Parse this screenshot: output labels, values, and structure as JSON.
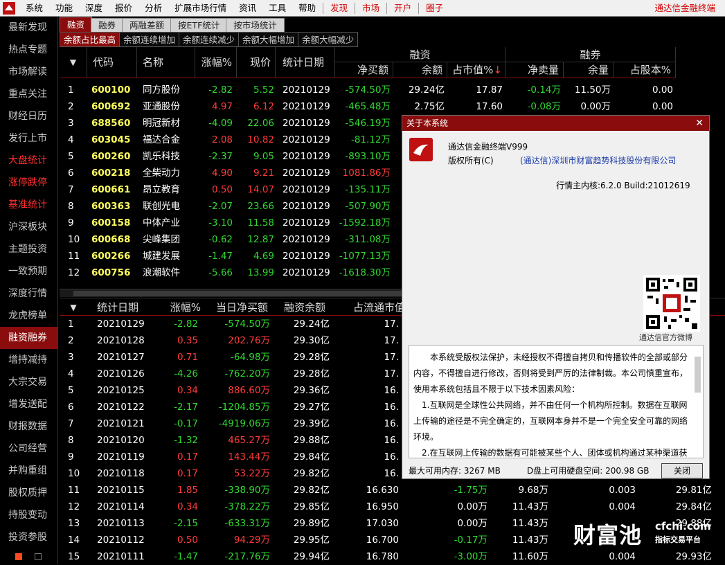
{
  "menubar": {
    "items": [
      "系统",
      "功能",
      "深度",
      "报价",
      "分析",
      "扩展市场行情",
      "资讯",
      "工具",
      "帮助"
    ],
    "red_items": [
      "发现",
      "市场",
      "开户",
      "圈子"
    ],
    "app_title": "通达信金融终端"
  },
  "sidebar": {
    "items": [
      {
        "label": "最新发现",
        "style": "normal"
      },
      {
        "label": "热点专题",
        "style": "normal"
      },
      {
        "label": "市场解读",
        "style": "normal"
      },
      {
        "label": "重点关注",
        "style": "normal"
      },
      {
        "label": "财经日历",
        "style": "normal"
      },
      {
        "label": "发行上市",
        "style": "normal"
      },
      {
        "label": "大盘统计",
        "style": "red"
      },
      {
        "label": "涨停跌停",
        "style": "red"
      },
      {
        "label": "基准统计",
        "style": "red"
      },
      {
        "label": "沪深板块",
        "style": "normal"
      },
      {
        "label": "主题投资",
        "style": "normal"
      },
      {
        "label": "一致预期",
        "style": "normal"
      },
      {
        "label": "深度行情",
        "style": "normal"
      },
      {
        "label": "龙虎榜单",
        "style": "normal"
      },
      {
        "label": "融资融券",
        "style": "active"
      },
      {
        "label": "增持减持",
        "style": "normal"
      },
      {
        "label": "大宗交易",
        "style": "normal"
      },
      {
        "label": "增发送配",
        "style": "normal"
      },
      {
        "label": "财报数据",
        "style": "normal"
      },
      {
        "label": "公司经营",
        "style": "normal"
      },
      {
        "label": "并购重组",
        "style": "normal"
      },
      {
        "label": "股权质押",
        "style": "normal"
      },
      {
        "label": "持股变动",
        "style": "normal"
      },
      {
        "label": "投资参股",
        "style": "normal"
      }
    ]
  },
  "tabs_top": [
    "融资",
    "融券",
    "两融差额",
    "按ETF统计",
    "按市场统计"
  ],
  "tabs_sub": [
    "余额占比最高",
    "余额连续增加",
    "余额连续减少",
    "余额大幅增加",
    "余额大幅减少"
  ],
  "table1": {
    "headers": {
      "code": "代码",
      "name": "名称",
      "change": "涨幅%",
      "price": "现价",
      "date": "统计日期",
      "group_fin": "融资",
      "group_sec": "融券",
      "fin_net": "净买额",
      "fin_bal": "余额",
      "fin_mkt": "占市值%",
      "sec_net": "净卖量",
      "sec_bal": "余量",
      "sec_share": "占股本%"
    },
    "sort_arrow": "↓",
    "rows": [
      {
        "idx": "1",
        "code": "600100",
        "name": "同方股份",
        "change": "-2.82",
        "price": "5.52",
        "date": "20210129",
        "fin_net": "-574.50万",
        "fin_bal": "29.24亿",
        "fin_mkt": "17.87",
        "sec_net": "-0.14万",
        "sec_bal": "11.50万",
        "sec_share": "0.00"
      },
      {
        "idx": "2",
        "code": "600692",
        "name": "亚通股份",
        "change": "4.97",
        "price": "6.12",
        "date": "20210129",
        "fin_net": "-465.48万",
        "fin_bal": "2.75亿",
        "fin_mkt": "17.60",
        "sec_net": "-0.08万",
        "sec_bal": "0.00万",
        "sec_share": "0.00"
      },
      {
        "idx": "3",
        "code": "688560",
        "name": "明冠新材",
        "change": "-4.09",
        "price": "22.06",
        "date": "20210129",
        "fin_net": "-546.19万"
      },
      {
        "idx": "4",
        "code": "603045",
        "name": "福达合金",
        "change": "2.08",
        "price": "10.82",
        "date": "20210129",
        "fin_net": "-81.12万"
      },
      {
        "idx": "5",
        "code": "600260",
        "name": "凯乐科技",
        "change": "-2.37",
        "price": "9.05",
        "date": "20210129",
        "fin_net": "-893.10万"
      },
      {
        "idx": "6",
        "code": "600218",
        "name": "全柴动力",
        "change": "4.90",
        "price": "9.21",
        "date": "20210129",
        "fin_net": "1081.86万"
      },
      {
        "idx": "7",
        "code": "600661",
        "name": "昂立教育",
        "change": "0.50",
        "price": "14.07",
        "date": "20210129",
        "fin_net": "-135.11万"
      },
      {
        "idx": "8",
        "code": "600363",
        "name": "联创光电",
        "change": "-2.07",
        "price": "23.66",
        "date": "20210129",
        "fin_net": "-507.90万"
      },
      {
        "idx": "9",
        "code": "600158",
        "name": "中体产业",
        "change": "-3.10",
        "price": "11.58",
        "date": "20210129",
        "fin_net": "-1592.18万"
      },
      {
        "idx": "10",
        "code": "600668",
        "name": "尖峰集团",
        "change": "-0.62",
        "price": "12.87",
        "date": "20210129",
        "fin_net": "-311.08万"
      },
      {
        "idx": "11",
        "code": "600266",
        "name": "城建发展",
        "change": "-1.47",
        "price": "4.69",
        "date": "20210129",
        "fin_net": "-1077.13万"
      },
      {
        "idx": "12",
        "code": "600756",
        "name": "浪潮软件",
        "change": "-5.66",
        "price": "13.99",
        "date": "20210129",
        "fin_net": "-1618.30万"
      }
    ]
  },
  "table2": {
    "headers": {
      "date": "统计日期",
      "change": "涨幅%",
      "net": "当日净买额",
      "bal": "融资余额",
      "mktcap": "占流通市值"
    },
    "rows": [
      {
        "idx": "1",
        "date": "20210129",
        "change": "-2.82",
        "net": "-574.50万",
        "bal": "29.24亿",
        "mkt": "17.",
        "c6": "",
        "c7": "",
        "c8": "",
        "c9": ""
      },
      {
        "idx": "2",
        "date": "20210128",
        "change": "0.35",
        "net": "202.76万",
        "bal": "29.30亿",
        "mkt": "17.",
        "c6": "",
        "c7": "",
        "c8": "",
        "c9": ""
      },
      {
        "idx": "3",
        "date": "20210127",
        "change": "0.71",
        "net": "-64.98万",
        "bal": "29.28亿",
        "mkt": "17.",
        "c6": "",
        "c7": "",
        "c8": "",
        "c9": ""
      },
      {
        "idx": "4",
        "date": "20210126",
        "change": "-4.26",
        "net": "-762.20万",
        "bal": "29.28亿",
        "mkt": "17.",
        "c6": "",
        "c7": "",
        "c8": "",
        "c9": ""
      },
      {
        "idx": "5",
        "date": "20210125",
        "change": "0.34",
        "net": "886.60万",
        "bal": "29.36亿",
        "mkt": "16.",
        "c6": "",
        "c7": "",
        "c8": "",
        "c9": ""
      },
      {
        "idx": "6",
        "date": "20210122",
        "change": "-2.17",
        "net": "-1204.85万",
        "bal": "29.27亿",
        "mkt": "16.",
        "c6": "",
        "c7": "",
        "c8": "",
        "c9": ""
      },
      {
        "idx": "7",
        "date": "20210121",
        "change": "-0.17",
        "net": "-4919.06万",
        "bal": "29.39亿",
        "mkt": "16.",
        "c6": "",
        "c7": "",
        "c8": "",
        "c9": ""
      },
      {
        "idx": "8",
        "date": "20210120",
        "change": "-1.32",
        "net": "465.27万",
        "bal": "29.88亿",
        "mkt": "16.",
        "c6": "",
        "c7": "",
        "c8": "",
        "c9": ""
      },
      {
        "idx": "9",
        "date": "20210119",
        "change": "0.17",
        "net": "143.44万",
        "bal": "29.84亿",
        "mkt": "16.",
        "c6": "",
        "c7": "",
        "c8": "",
        "c9": ""
      },
      {
        "idx": "10",
        "date": "20210118",
        "change": "0.17",
        "net": "53.22万",
        "bal": "29.82亿",
        "mkt": "16.",
        "c6": "",
        "c7": "",
        "c8": "",
        "c9": ""
      },
      {
        "idx": "11",
        "date": "20210115",
        "change": "1.85",
        "net": "-338.90万",
        "bal": "29.82亿",
        "mkt": "16.630",
        "c6": "-1.75万",
        "c7": "9.68万",
        "c8": "0.003",
        "c9": "29.81亿"
      },
      {
        "idx": "12",
        "date": "20210114",
        "change": "0.34",
        "net": "-378.22万",
        "bal": "29.85亿",
        "mkt": "16.950",
        "c6": "0.00万",
        "c7": "11.43万",
        "c8": "0.004",
        "c9": "29.84亿"
      },
      {
        "idx": "13",
        "date": "20210113",
        "change": "-2.15",
        "net": "-633.31万",
        "bal": "29.89亿",
        "mkt": "17.030",
        "c6": "0.00万",
        "c7": "11.43万",
        "c8": "",
        "c9": "29.88亿"
      },
      {
        "idx": "14",
        "date": "20210112",
        "change": "0.50",
        "net": "94.29万",
        "bal": "29.95亿",
        "mkt": "16.700",
        "c6": "-0.17万",
        "c7": "11.43万",
        "c8": "",
        "c9": ""
      },
      {
        "idx": "15",
        "date": "20210111",
        "change": "-1.47",
        "net": "-217.76万",
        "bal": "29.94亿",
        "mkt": "16.780",
        "c6": "-3.00万",
        "c7": "11.60万",
        "c8": "0.004",
        "c9": "29.93亿"
      }
    ]
  },
  "dialog": {
    "title": "关于本系统",
    "close_glyph": "✕",
    "product": "通达信金融终端V999",
    "copyright_label": "版权所有(C)",
    "company": "(通达信)深圳市财富趋势科技股份有限公司",
    "build": "行情主内核:6.2.0 Build:21012619",
    "qr_caption": "通达信官方微博",
    "notice": [
      "本系统受版权法保护，未经授权不得擅自拷贝和传播软件的全部或部分内容，不得擅自进行修改，否则将受到严厉的法律制裁。本公司慎重宣布，使用本系统包括且不限于以下技术因素风险：",
      "1.互联网是全球性公共网络，并不由任何一个机构所控制。数据在互联网上传输的途径是不完全确定的，互联网本身并不是一个完全安全可靠的网络环境。",
      "2.在互联网上传输的数据有可能被某些个人、团体或机构通过某种渠道获"
    ],
    "memory": "最大可用内存: 3267 MB",
    "disk": "D盘上可用硬盘空间: 200.98 GB",
    "button": "关闭"
  },
  "watermark": {
    "text": "财富池",
    "domain": "cfchi.com",
    "sub": "指标交易平台"
  },
  "colors": {
    "up": "#ff3b3b",
    "down": "#31d831",
    "code": "#ffff60",
    "accent": "#8a0c0c"
  }
}
